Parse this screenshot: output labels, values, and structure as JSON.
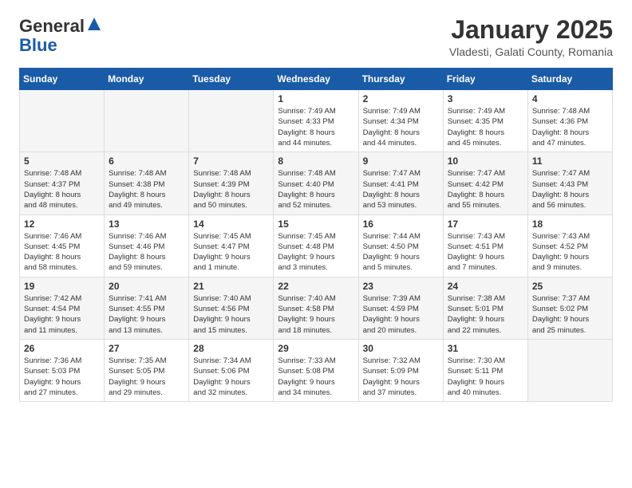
{
  "logo": {
    "general": "General",
    "blue": "Blue"
  },
  "header": {
    "month": "January 2025",
    "location": "Vladesti, Galati County, Romania"
  },
  "weekdays": [
    "Sunday",
    "Monday",
    "Tuesday",
    "Wednesday",
    "Thursday",
    "Friday",
    "Saturday"
  ],
  "weeks": [
    [
      {
        "day": "",
        "content": ""
      },
      {
        "day": "",
        "content": ""
      },
      {
        "day": "",
        "content": ""
      },
      {
        "day": "1",
        "content": "Sunrise: 7:49 AM\nSunset: 4:33 PM\nDaylight: 8 hours\nand 44 minutes."
      },
      {
        "day": "2",
        "content": "Sunrise: 7:49 AM\nSunset: 4:34 PM\nDaylight: 8 hours\nand 44 minutes."
      },
      {
        "day": "3",
        "content": "Sunrise: 7:49 AM\nSunset: 4:35 PM\nDaylight: 8 hours\nand 45 minutes."
      },
      {
        "day": "4",
        "content": "Sunrise: 7:48 AM\nSunset: 4:36 PM\nDaylight: 8 hours\nand 47 minutes."
      }
    ],
    [
      {
        "day": "5",
        "content": "Sunrise: 7:48 AM\nSunset: 4:37 PM\nDaylight: 8 hours\nand 48 minutes."
      },
      {
        "day": "6",
        "content": "Sunrise: 7:48 AM\nSunset: 4:38 PM\nDaylight: 8 hours\nand 49 minutes."
      },
      {
        "day": "7",
        "content": "Sunrise: 7:48 AM\nSunset: 4:39 PM\nDaylight: 8 hours\nand 50 minutes."
      },
      {
        "day": "8",
        "content": "Sunrise: 7:48 AM\nSunset: 4:40 PM\nDaylight: 8 hours\nand 52 minutes."
      },
      {
        "day": "9",
        "content": "Sunrise: 7:47 AM\nSunset: 4:41 PM\nDaylight: 8 hours\nand 53 minutes."
      },
      {
        "day": "10",
        "content": "Sunrise: 7:47 AM\nSunset: 4:42 PM\nDaylight: 8 hours\nand 55 minutes."
      },
      {
        "day": "11",
        "content": "Sunrise: 7:47 AM\nSunset: 4:43 PM\nDaylight: 8 hours\nand 56 minutes."
      }
    ],
    [
      {
        "day": "12",
        "content": "Sunrise: 7:46 AM\nSunset: 4:45 PM\nDaylight: 8 hours\nand 58 minutes."
      },
      {
        "day": "13",
        "content": "Sunrise: 7:46 AM\nSunset: 4:46 PM\nDaylight: 8 hours\nand 59 minutes."
      },
      {
        "day": "14",
        "content": "Sunrise: 7:45 AM\nSunset: 4:47 PM\nDaylight: 9 hours\nand 1 minute."
      },
      {
        "day": "15",
        "content": "Sunrise: 7:45 AM\nSunset: 4:48 PM\nDaylight: 9 hours\nand 3 minutes."
      },
      {
        "day": "16",
        "content": "Sunrise: 7:44 AM\nSunset: 4:50 PM\nDaylight: 9 hours\nand 5 minutes."
      },
      {
        "day": "17",
        "content": "Sunrise: 7:43 AM\nSunset: 4:51 PM\nDaylight: 9 hours\nand 7 minutes."
      },
      {
        "day": "18",
        "content": "Sunrise: 7:43 AM\nSunset: 4:52 PM\nDaylight: 9 hours\nand 9 minutes."
      }
    ],
    [
      {
        "day": "19",
        "content": "Sunrise: 7:42 AM\nSunset: 4:54 PM\nDaylight: 9 hours\nand 11 minutes."
      },
      {
        "day": "20",
        "content": "Sunrise: 7:41 AM\nSunset: 4:55 PM\nDaylight: 9 hours\nand 13 minutes."
      },
      {
        "day": "21",
        "content": "Sunrise: 7:40 AM\nSunset: 4:56 PM\nDaylight: 9 hours\nand 15 minutes."
      },
      {
        "day": "22",
        "content": "Sunrise: 7:40 AM\nSunset: 4:58 PM\nDaylight: 9 hours\nand 18 minutes."
      },
      {
        "day": "23",
        "content": "Sunrise: 7:39 AM\nSunset: 4:59 PM\nDaylight: 9 hours\nand 20 minutes."
      },
      {
        "day": "24",
        "content": "Sunrise: 7:38 AM\nSunset: 5:01 PM\nDaylight: 9 hours\nand 22 minutes."
      },
      {
        "day": "25",
        "content": "Sunrise: 7:37 AM\nSunset: 5:02 PM\nDaylight: 9 hours\nand 25 minutes."
      }
    ],
    [
      {
        "day": "26",
        "content": "Sunrise: 7:36 AM\nSunset: 5:03 PM\nDaylight: 9 hours\nand 27 minutes."
      },
      {
        "day": "27",
        "content": "Sunrise: 7:35 AM\nSunset: 5:05 PM\nDaylight: 9 hours\nand 29 minutes."
      },
      {
        "day": "28",
        "content": "Sunrise: 7:34 AM\nSunset: 5:06 PM\nDaylight: 9 hours\nand 32 minutes."
      },
      {
        "day": "29",
        "content": "Sunrise: 7:33 AM\nSunset: 5:08 PM\nDaylight: 9 hours\nand 34 minutes."
      },
      {
        "day": "30",
        "content": "Sunrise: 7:32 AM\nSunset: 5:09 PM\nDaylight: 9 hours\nand 37 minutes."
      },
      {
        "day": "31",
        "content": "Sunrise: 7:30 AM\nSunset: 5:11 PM\nDaylight: 9 hours\nand 40 minutes."
      },
      {
        "day": "",
        "content": ""
      }
    ]
  ]
}
